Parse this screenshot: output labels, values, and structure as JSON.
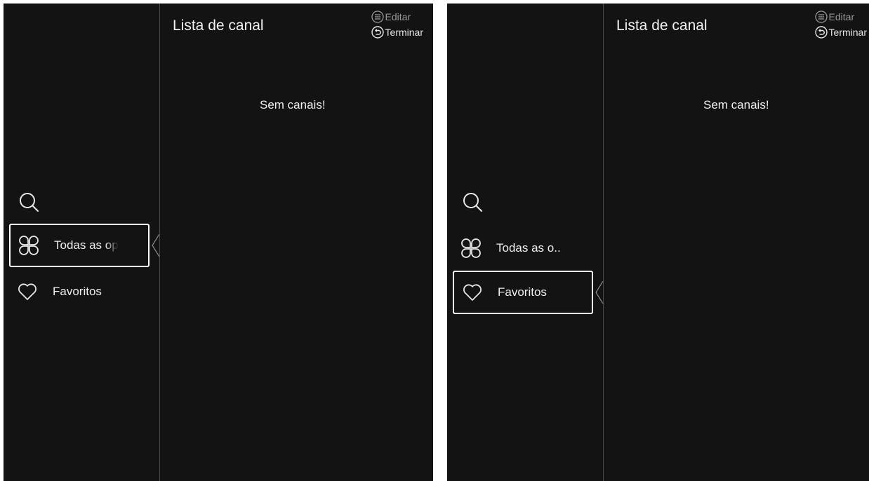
{
  "screens": [
    {
      "header": {
        "title": "Lista de canal",
        "edit_label": "Editar",
        "finish_label": "Terminar",
        "edit_icon": "menu-circle-icon",
        "finish_icon": "back-circle-icon"
      },
      "empty_message": "Sem canais!",
      "sidebar": {
        "search_icon": "search-icon",
        "items": [
          {
            "label": "Todas as op",
            "icon": "clover-icon",
            "focused": true
          },
          {
            "label": "Favoritos",
            "icon": "heart-icon",
            "focused": false
          }
        ]
      }
    },
    {
      "header": {
        "title": "Lista de canal",
        "edit_label": "Editar",
        "finish_label": "Terminar",
        "edit_icon": "menu-circle-icon",
        "finish_icon": "back-circle-icon"
      },
      "empty_message": "Sem canais!",
      "sidebar": {
        "search_icon": "search-icon",
        "items": [
          {
            "label": "Todas as o..",
            "icon": "clover-icon",
            "focused": false
          },
          {
            "label": "Favoritos",
            "icon": "heart-icon",
            "focused": true
          }
        ]
      }
    }
  ],
  "colors": {
    "background": "#131313",
    "divider": "#4a4a4a",
    "focus_border": "#ffffff",
    "text_primary": "#f2f2f2",
    "text_dim": "#9a9a9a"
  }
}
